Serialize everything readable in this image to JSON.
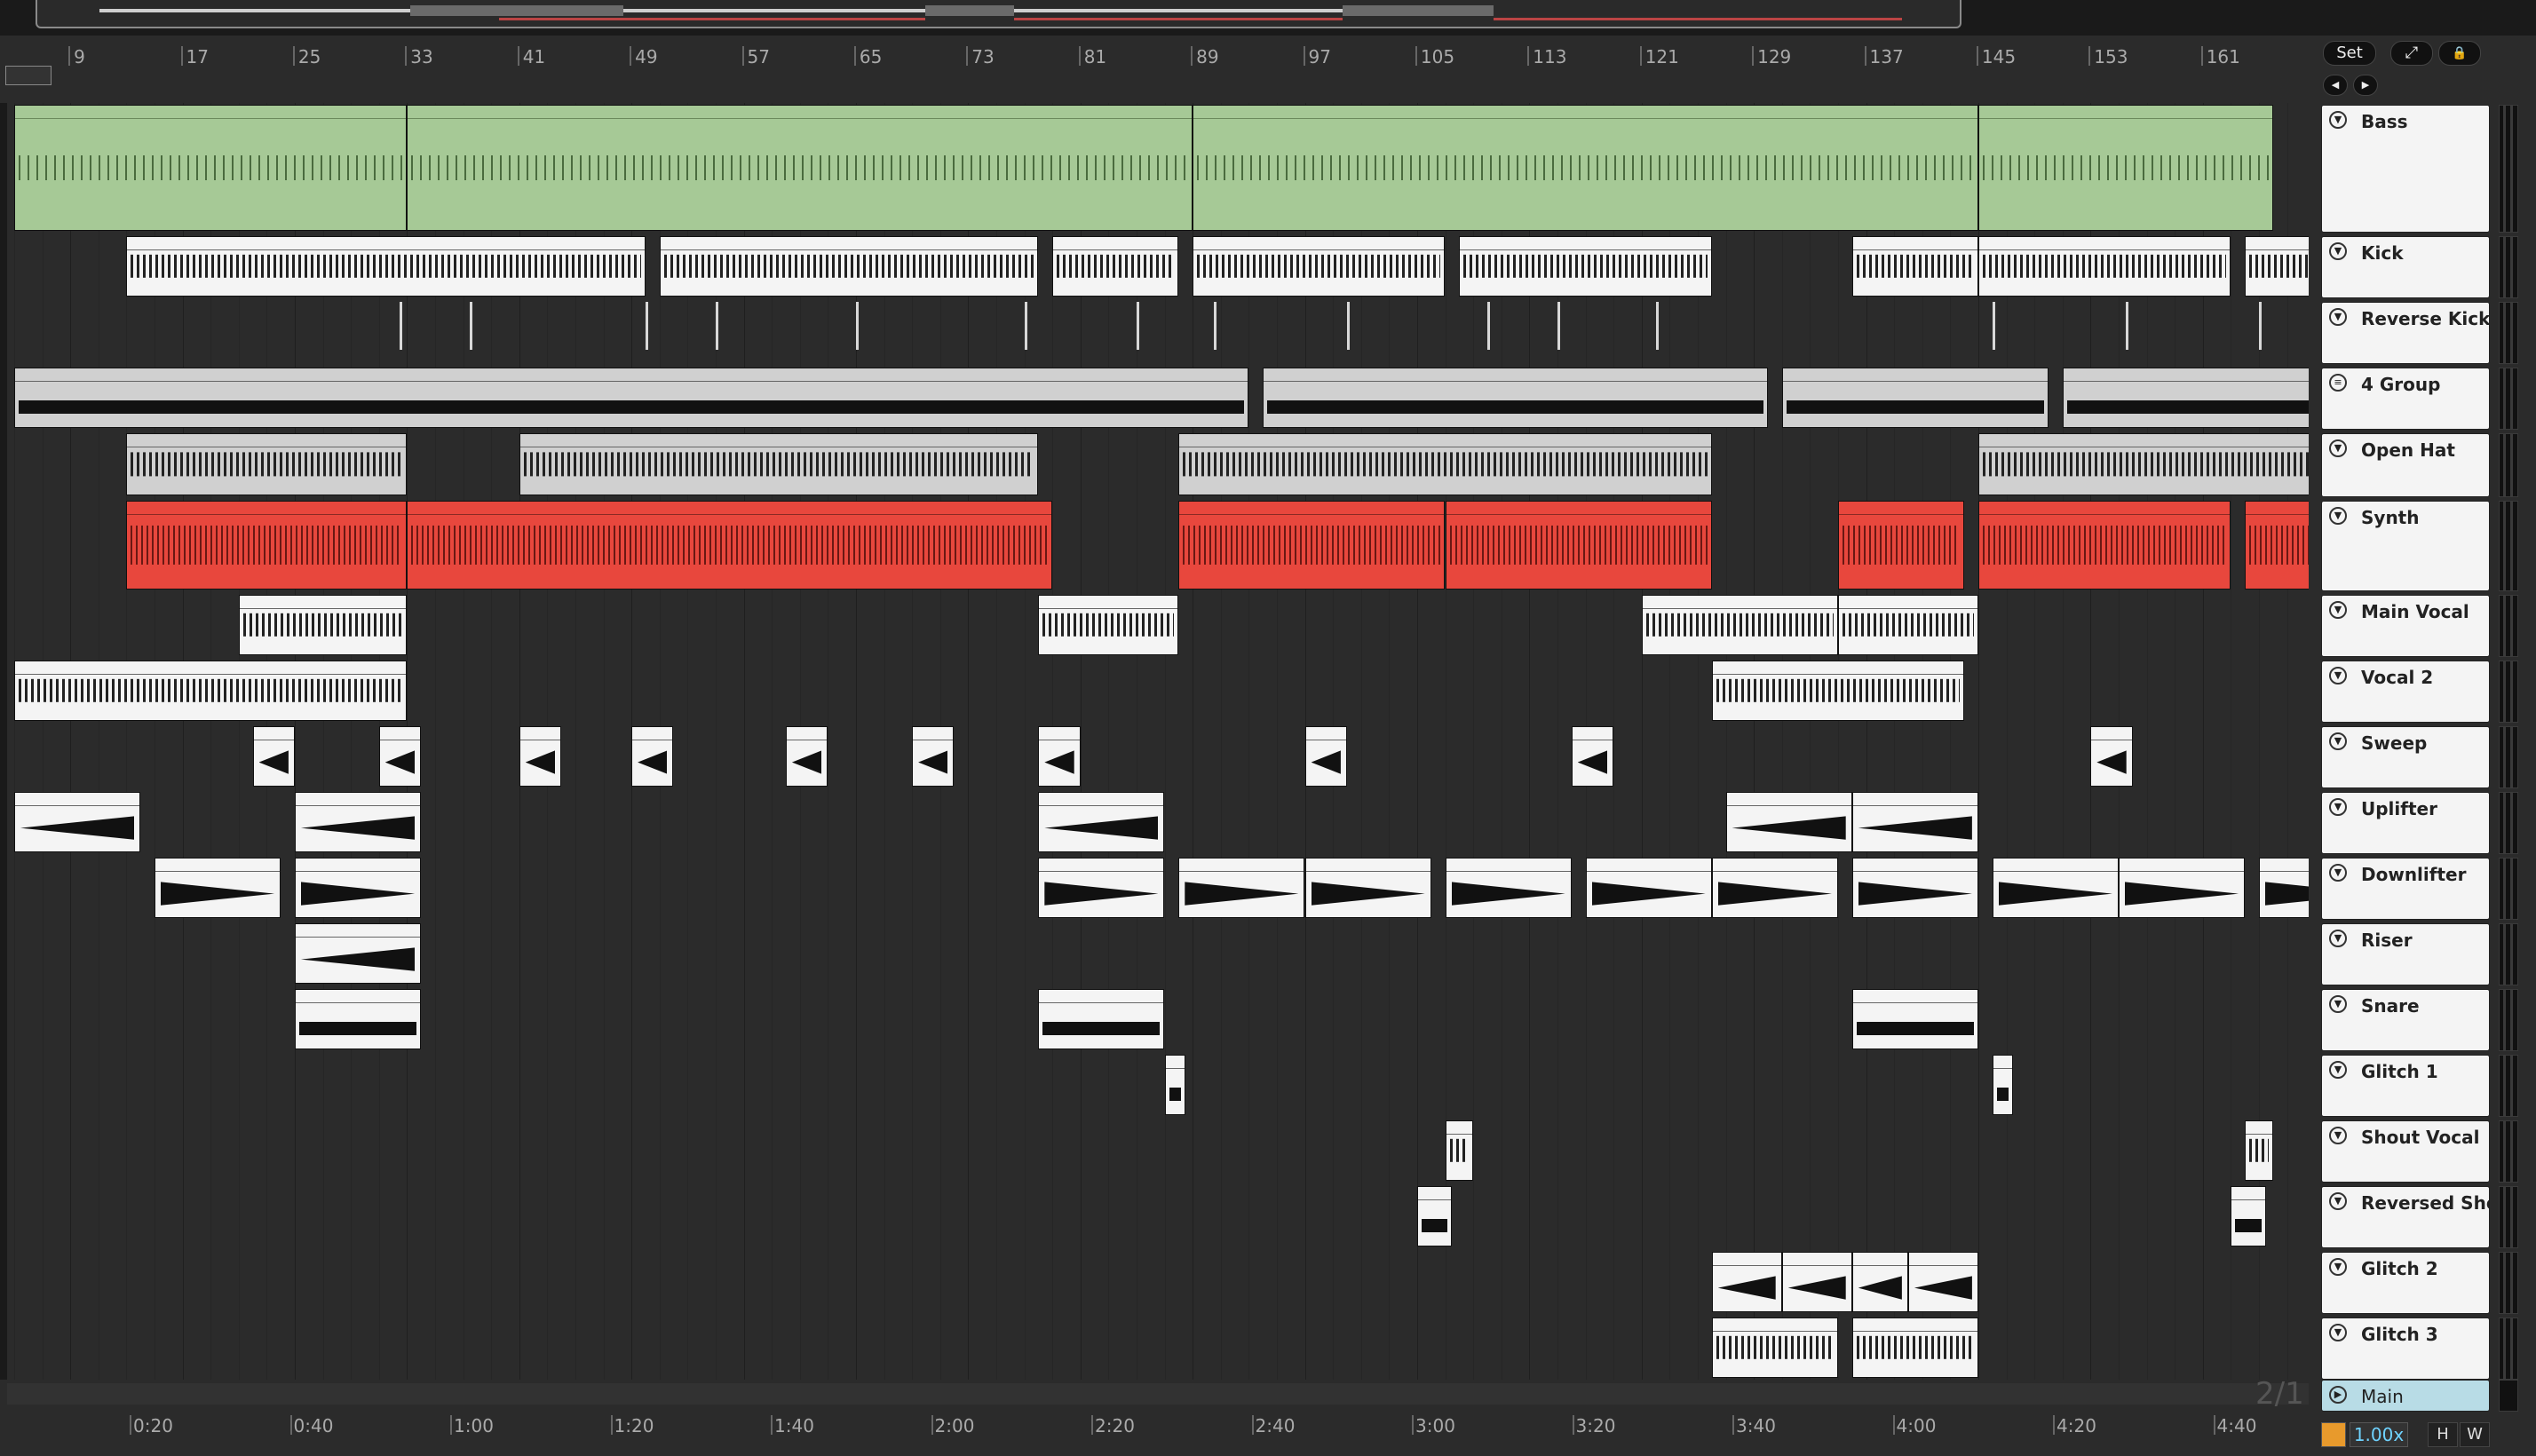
{
  "toolbar": {
    "set_label": "Set",
    "expand_label": "⤢",
    "lock_label": "🔒",
    "nav_back": "◀",
    "nav_fwd": "▶"
  },
  "ruler": {
    "bars": [
      "9",
      "17",
      "25",
      "33",
      "41",
      "49",
      "57",
      "65",
      "73",
      "81",
      "89",
      "97",
      "105",
      "113",
      "121",
      "129",
      "137",
      "145",
      "153",
      "161"
    ]
  },
  "timeline": {
    "times": [
      "0:20",
      "0:40",
      "1:00",
      "1:20",
      "1:40",
      "2:00",
      "2:20",
      "2:40",
      "3:00",
      "3:20",
      "3:40",
      "4:00",
      "4:20",
      "4:40"
    ]
  },
  "tracks": [
    {
      "name": "Bass",
      "fold_icon": "▼"
    },
    {
      "name": "Kick",
      "fold_icon": "▼"
    },
    {
      "name": "Reverse Kick",
      "fold_icon": "▼"
    },
    {
      "name": "4 Group",
      "fold_icon": "≡"
    },
    {
      "name": "Open Hat",
      "fold_icon": "▼"
    },
    {
      "name": "Synth",
      "fold_icon": "▼"
    },
    {
      "name": "Main Vocal",
      "fold_icon": "▼"
    },
    {
      "name": "Vocal 2",
      "fold_icon": "▼"
    },
    {
      "name": "Sweep",
      "fold_icon": "▼"
    },
    {
      "name": "Uplifter",
      "fold_icon": "▼"
    },
    {
      "name": "Downlifter",
      "fold_icon": "▼"
    },
    {
      "name": "Riser",
      "fold_icon": "▼"
    },
    {
      "name": "Snare",
      "fold_icon": "▼"
    },
    {
      "name": "Glitch 1",
      "fold_icon": "▼"
    },
    {
      "name": "Shout Vocal",
      "fold_icon": "▼"
    },
    {
      "name": "Reversed Shou",
      "fold_icon": "▼"
    },
    {
      "name": "Glitch 2",
      "fold_icon": "▼"
    },
    {
      "name": "Glitch 3",
      "fold_icon": "▼"
    }
  ],
  "main_track": {
    "name": "Main",
    "fold_icon": "▶"
  },
  "status": {
    "quantization": "2/1",
    "zoom": "1.00x",
    "h_label": "H",
    "w_label": "W"
  },
  "colors": {
    "bass_clip": "#a6c996",
    "synth_clip": "#e8473d",
    "audio_clip": "#f4f4f4",
    "main_track": "#b8dce6",
    "zoom_text": "#6fd3ff",
    "background": "#2b2b2b"
  }
}
